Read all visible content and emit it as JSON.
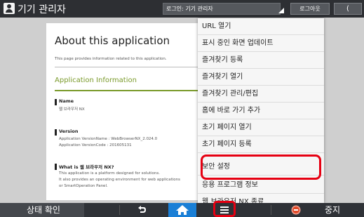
{
  "header": {
    "title": "기기 관리자",
    "login_text": "로그인: 기기 관리자",
    "logout_label": "로그아웃",
    "back_label": "("
  },
  "page": {
    "heading": "About this application",
    "intro": "This page provides information related to this application.",
    "section_title": "Application Information",
    "name": {
      "label": "Name",
      "value": "웹 브라우저 NX"
    },
    "version": {
      "label": "Version",
      "lines": [
        "Application VersionName  :  WebBrowserNX_2.024.0",
        "Application VersionCode  :  201605131"
      ]
    },
    "what": {
      "label": "What is 웹 브라우저 NX?",
      "lines": [
        "This application is a platform designed for solutions.",
        "It also provides an operating environment for web applications",
        "or SmartOperation Panel."
      ]
    }
  },
  "menu": {
    "items": [
      "URL 열기",
      "표시 중인 화면 업데이트",
      "즐겨찾기 등록",
      "즐겨찾기 열기",
      "즐겨찾기 관리/편집",
      "홈에 바로 가기 추가",
      "초기 페이지 열기",
      "초기 페이지 등록",
      "보안 설정",
      "응용 프로그램 정보",
      "웹 브라우저 NX 종료"
    ],
    "highlighted": "보안 설정"
  },
  "bottombar": {
    "status_label": "상태 확인",
    "stop_label": "중지",
    "icons": [
      "back-arrow-icon",
      "home-icon",
      "menu-icon",
      "stop-icon"
    ],
    "home_color": "#1a7fd6",
    "highlight_color": "#e60012"
  }
}
